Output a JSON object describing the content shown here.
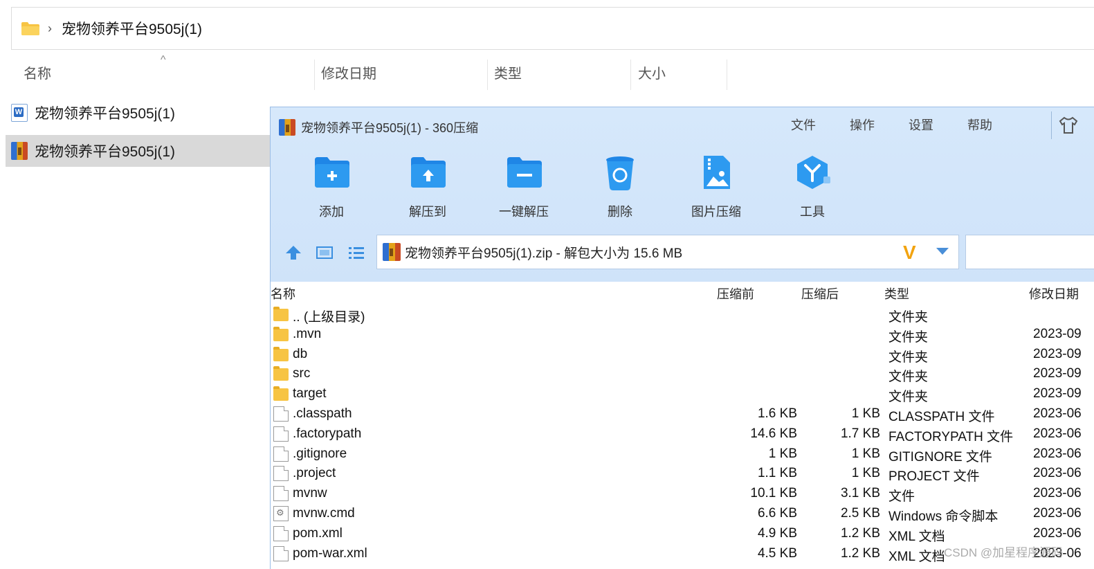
{
  "explorer": {
    "breadcrumb": "宠物领养平台9505j(1)",
    "columns": [
      "名称",
      "修改日期",
      "类型",
      "大小"
    ],
    "sort_arrow": "^",
    "items": [
      {
        "name": "宠物领养平台9505j(1)",
        "icon": "word-doc-icon"
      },
      {
        "name": "宠物领养平台9505j(1)",
        "icon": "zip-archive-icon"
      }
    ]
  },
  "zipwin": {
    "title": "宠物领养平台9505j(1) - 360压缩",
    "menu": [
      "文件",
      "操作",
      "设置",
      "帮助"
    ],
    "tools": [
      {
        "label": "添加",
        "icon": "add-icon"
      },
      {
        "label": "解压到",
        "icon": "extract-to-icon"
      },
      {
        "label": "一键解压",
        "icon": "one-click-extract-icon"
      },
      {
        "label": "删除",
        "icon": "delete-icon"
      },
      {
        "label": "图片压缩",
        "icon": "image-compress-icon"
      },
      {
        "label": "工具",
        "icon": "tools-icon"
      }
    ],
    "path": "宠物领养平台9505j(1).zip - 解包大小为 15.6 MB",
    "vlogo": "V",
    "columns": [
      "名称",
      "压缩前",
      "压缩后",
      "类型",
      "修改日期"
    ],
    "rows": [
      {
        "name": ".. (上级目录)",
        "orig": "",
        "comp": "",
        "type": "文件夹",
        "date": "",
        "kind": "folder"
      },
      {
        "name": ".mvn",
        "orig": "",
        "comp": "",
        "type": "文件夹",
        "date": "2023-09",
        "kind": "folder"
      },
      {
        "name": "db",
        "orig": "",
        "comp": "",
        "type": "文件夹",
        "date": "2023-09",
        "kind": "folder"
      },
      {
        "name": "src",
        "orig": "",
        "comp": "",
        "type": "文件夹",
        "date": "2023-09",
        "kind": "folder"
      },
      {
        "name": "target",
        "orig": "",
        "comp": "",
        "type": "文件夹",
        "date": "2023-09",
        "kind": "folder"
      },
      {
        "name": ".classpath",
        "orig": "1.6 KB",
        "comp": "1 KB",
        "type": "CLASSPATH 文件",
        "date": "2023-06",
        "kind": "file"
      },
      {
        "name": ".factorypath",
        "orig": "14.6 KB",
        "comp": "1.7 KB",
        "type": "FACTORYPATH 文件",
        "date": "2023-06",
        "kind": "file"
      },
      {
        "name": ".gitignore",
        "orig": "1 KB",
        "comp": "1 KB",
        "type": "GITIGNORE 文件",
        "date": "2023-06",
        "kind": "file"
      },
      {
        "name": ".project",
        "orig": "1.1 KB",
        "comp": "1 KB",
        "type": "PROJECT 文件",
        "date": "2023-06",
        "kind": "file"
      },
      {
        "name": "mvnw",
        "orig": "10.1 KB",
        "comp": "3.1 KB",
        "type": "文件",
        "date": "2023-06",
        "kind": "file"
      },
      {
        "name": "mvnw.cmd",
        "orig": "6.6 KB",
        "comp": "2.5 KB",
        "type": "Windows 命令脚本",
        "date": "2023-06",
        "kind": "cmd"
      },
      {
        "name": "pom.xml",
        "orig": "4.9 KB",
        "comp": "1.2 KB",
        "type": "XML 文档",
        "date": "2023-06",
        "kind": "file"
      },
      {
        "name": "pom-war.xml",
        "orig": "4.5 KB",
        "comp": "1.2 KB",
        "type": "XML 文档",
        "date": "2023-06",
        "kind": "file"
      }
    ]
  },
  "watermark": "CSDN @加星程序源码",
  "colors": {
    "accent": "#2d8ae6",
    "toolbar_bg": "#d3e6fa",
    "folder": "#f7c443",
    "selected": "#d9d9d9"
  }
}
